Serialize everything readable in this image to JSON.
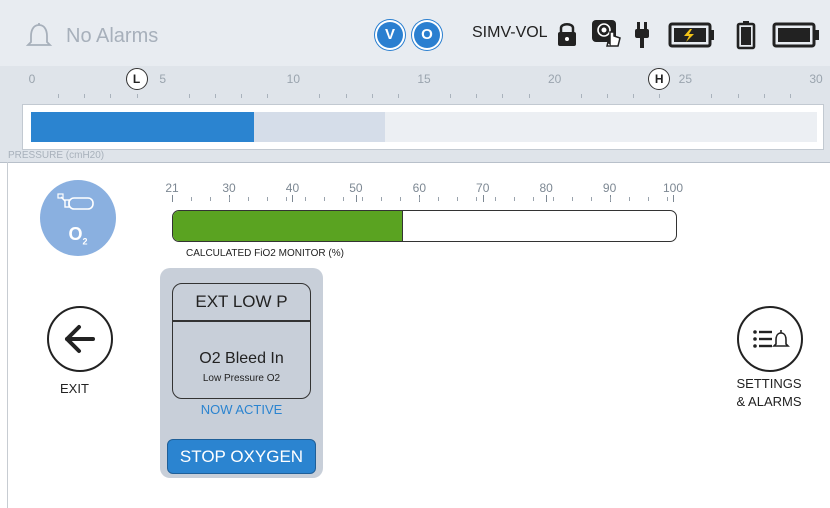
{
  "header": {
    "alarm_text": "No Alarms",
    "badge_v": "V",
    "badge_o": "O",
    "mode": "SIMV-VOL"
  },
  "pressure": {
    "ticks": [
      "0",
      "5",
      "10",
      "15",
      "20",
      "25",
      "30"
    ],
    "low_marker": "L",
    "high_marker": "H",
    "low_value": 4,
    "high_value": 24,
    "current_value": 8.5,
    "peak_value": 13.5,
    "max": 30,
    "label": "PRESSURE (cmH20)"
  },
  "fio2": {
    "ticks": [
      "21",
      "30",
      "40",
      "50",
      "60",
      "70",
      "80",
      "90",
      "100"
    ],
    "value": 57,
    "label": "CALCULATED FiO2 MONITOR (%)"
  },
  "o2_button": {
    "label": "O",
    "subscript": "2"
  },
  "exit": {
    "label": "EXIT"
  },
  "panel": {
    "title": "EXT LOW P",
    "main": "O2 Bleed In",
    "sub": "Low Pressure O2",
    "status": "NOW ACTIVE",
    "button": "STOP OXYGEN"
  },
  "settings": {
    "label_line1": "SETTINGS",
    "label_line2": "& ALARMS"
  },
  "colors": {
    "accent": "#2b84d0",
    "fio2_fill": "#5aa321",
    "pressure_fill": "#2b84d0"
  },
  "icons": [
    "bell-icon",
    "lock-icon",
    "touch-lock-icon",
    "plug-icon",
    "battery-charging-icon",
    "battery-vertical-icon",
    "battery-full-icon",
    "o2-cylinder-icon",
    "arrow-left-icon",
    "list-bell-icon"
  ]
}
